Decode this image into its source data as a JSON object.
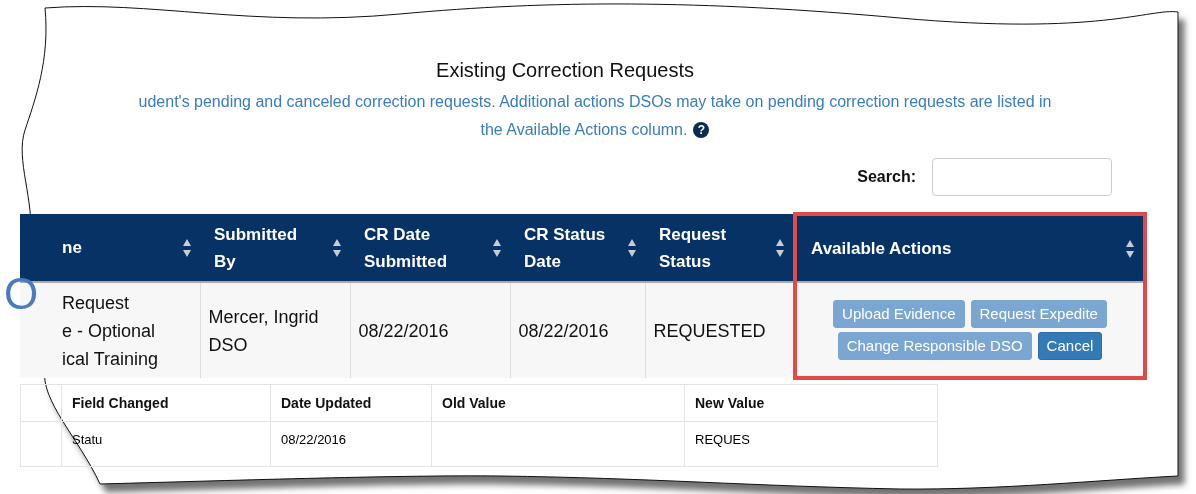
{
  "title": "Existing Correction Requests",
  "description": [
    "udent's pending and canceled correction requests. Additional actions DSOs may take on pending correction requests are listed in",
    "the Available Actions column."
  ],
  "help_icon": "?",
  "side_fragment": "O",
  "search": {
    "label": "Search:"
  },
  "table": {
    "columns": [
      {
        "label": "ne",
        "sortable": true,
        "highlighted": false
      },
      {
        "label": "Submitted\nBy",
        "sortable": true,
        "highlighted": false
      },
      {
        "label": "CR Date\nSubmitted",
        "sortable": true,
        "highlighted": false
      },
      {
        "label": "CR Status\nDate",
        "sortable": true,
        "highlighted": false
      },
      {
        "label": "Request\nStatus",
        "sortable": true,
        "highlighted": false
      },
      {
        "label": "Available Actions",
        "sortable": true,
        "highlighted": true
      }
    ],
    "rows": [
      {
        "cells": [
          "Request\ne - Optional\nical Training",
          "Mercer, Ingrid\nDSO",
          "08/22/2016",
          "08/22/2016",
          "REQUESTED"
        ],
        "actions": [
          {
            "label": "Upload Evidence",
            "disabled": true
          },
          {
            "label": "Request Expedite",
            "disabled": true
          },
          {
            "label": "Change Responsible DSO",
            "disabled": true
          },
          {
            "label": "Cancel",
            "disabled": false
          }
        ]
      }
    ]
  },
  "history": {
    "columns": [
      "",
      "Field Changed",
      "Date Updated",
      "Old Value",
      "New Value"
    ],
    "rows": [
      [
        "",
        "Statu",
        "08/22/2016",
        "",
        "REQUES"
      ]
    ]
  }
}
